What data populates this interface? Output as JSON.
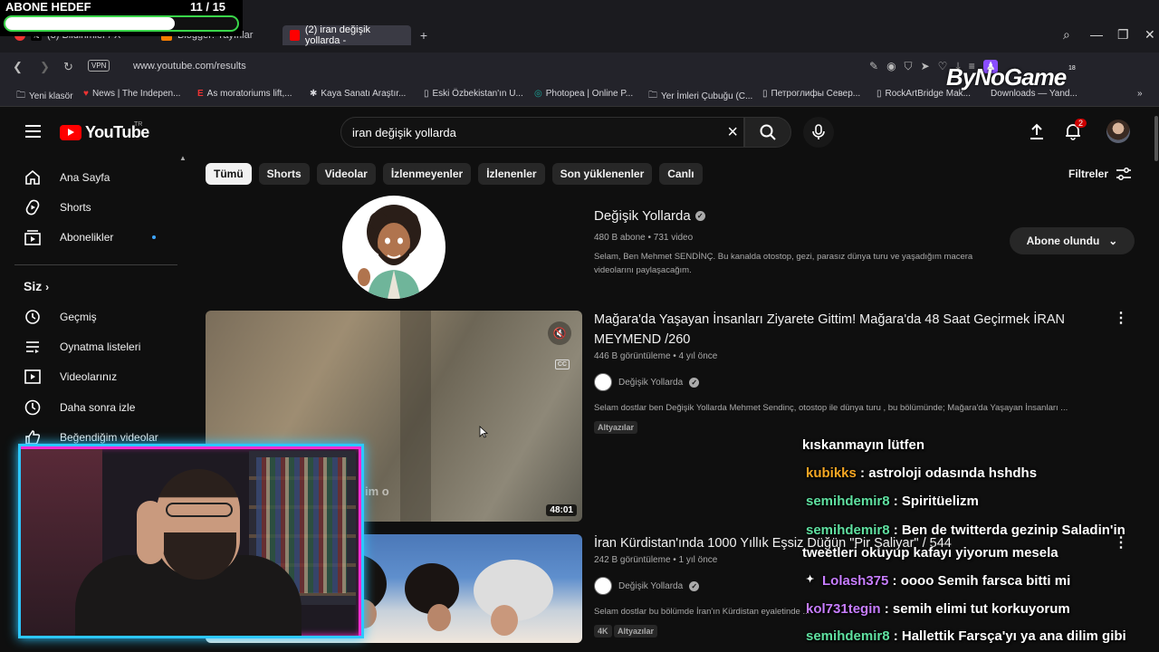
{
  "stream_goal": {
    "title": "ABONE HEDEF",
    "count": "11  / 15",
    "progress": 0.73
  },
  "browser": {
    "tabs": [
      {
        "label": "(3) Bildirimler / X",
        "active": false
      },
      {
        "label": "Blogger: Yayınlar",
        "active": false
      },
      {
        "label": "(2) iran değişik yollarda -",
        "active": true
      }
    ],
    "url": "www.youtube.com/results",
    "vpn": "VPN",
    "bookmarks": [
      "Yeni klasör",
      "News | The Indepen...",
      "As moratoriums lift,...",
      "Kaya Sanatı Araştır...",
      "Eski Özbekistan'ın U...",
      "Photopea | Online P...",
      "Yer İmleri Çubuğu (C...",
      "Петроглифы Север...",
      "RockArtBridge Mak...",
      "Downloads — Yand..."
    ],
    "ext_badge": "18"
  },
  "watermark": "ByNoGame",
  "youtube": {
    "logo": "YouTube",
    "region": "TR",
    "search_query": "iran değişik yollarda",
    "notification_count": "2",
    "sidebar": {
      "main": [
        "Ana Sayfa",
        "Shorts",
        "Abonelikler"
      ],
      "section_you": "Siz",
      "you_items": [
        "Geçmiş",
        "Oynatma listeleri",
        "Videolarınız",
        "Daha sonra izle",
        "Beğendiğim videolar"
      ]
    },
    "chips": [
      "Tümü",
      "Shorts",
      "Videolar",
      "İzlenmeyenler",
      "İzlenenler",
      "Son yüklenenler",
      "Canlı"
    ],
    "filters_label": "Filtreler",
    "channel": {
      "name": "Değişik Yollarda",
      "meta": "480 B abone • 731 video",
      "description": "Selam, Ben Mehmet SENDİNÇ. Bu kanalda otostop, gezi, parasız dünya turu ve yaşadığım macera videolarını paylaşacağım.",
      "subscribe_label": "Abone olundu"
    },
    "videos": [
      {
        "title": "Mağara'da Yaşayan İnsanları Ziyarete Gittim! Mağara'da 48 Saat Geçirmek İRAN MEYMEND /260",
        "meta": "446 B görüntüleme • 4 yıl önce",
        "channel": "Değişik Yollarda",
        "snippet": "Selam dostlar ben Değişik Yollarda Mehmet Sendinç, otostop ile dünya turu , bu bölümünde; Mağara'da Yaşayan İnsanları ...",
        "badges": [
          "Altyazılar"
        ],
        "duration": "48:01",
        "cc": "CC",
        "overlay_text": "im o"
      },
      {
        "title": "İran Kürdistan'ında 1000 Yıllık Eşsiz Düğün \"Pir Şaliyar\" / 544",
        "meta": "242 B görüntüleme • 1 yıl önce",
        "channel": "Değişik Yollarda",
        "snippet": "Selam dostlar bu bölümde İran'ın Kürdistan eyaletinde ...",
        "badges": [
          "4K",
          "Altyazılar"
        ]
      }
    ]
  },
  "chat": [
    {
      "user": "",
      "message": "kıskanmayın lütfen",
      "color": "#ffffff"
    },
    {
      "user": "kubikks",
      "message": " : astroloji odasında hshdhs",
      "color": "#f5a623"
    },
    {
      "user": "semihdemir8",
      "message": " : Spiritüelizm",
      "color": "#5fe0a0"
    },
    {
      "user": "semihdemir8",
      "message": " : Ben de twitterda gezinip Saladin'in",
      "color": "#5fe0a0"
    },
    {
      "user": "",
      "message": "tweetleri okuyup kafayı yiyorum mesela",
      "color": "#ffffff"
    },
    {
      "user": "Lolash375",
      "message": " : oooo Semih farsca bitti mi",
      "color": "#c77dff"
    },
    {
      "user": "kol731tegin",
      "message": " : semih elimi tut korkuyorum",
      "color": "#c77dff"
    },
    {
      "user": "semihdemir8",
      "message": " : Hallettik Farsça'yı ya ana dilim gibi",
      "color": "#5fe0a0"
    }
  ]
}
